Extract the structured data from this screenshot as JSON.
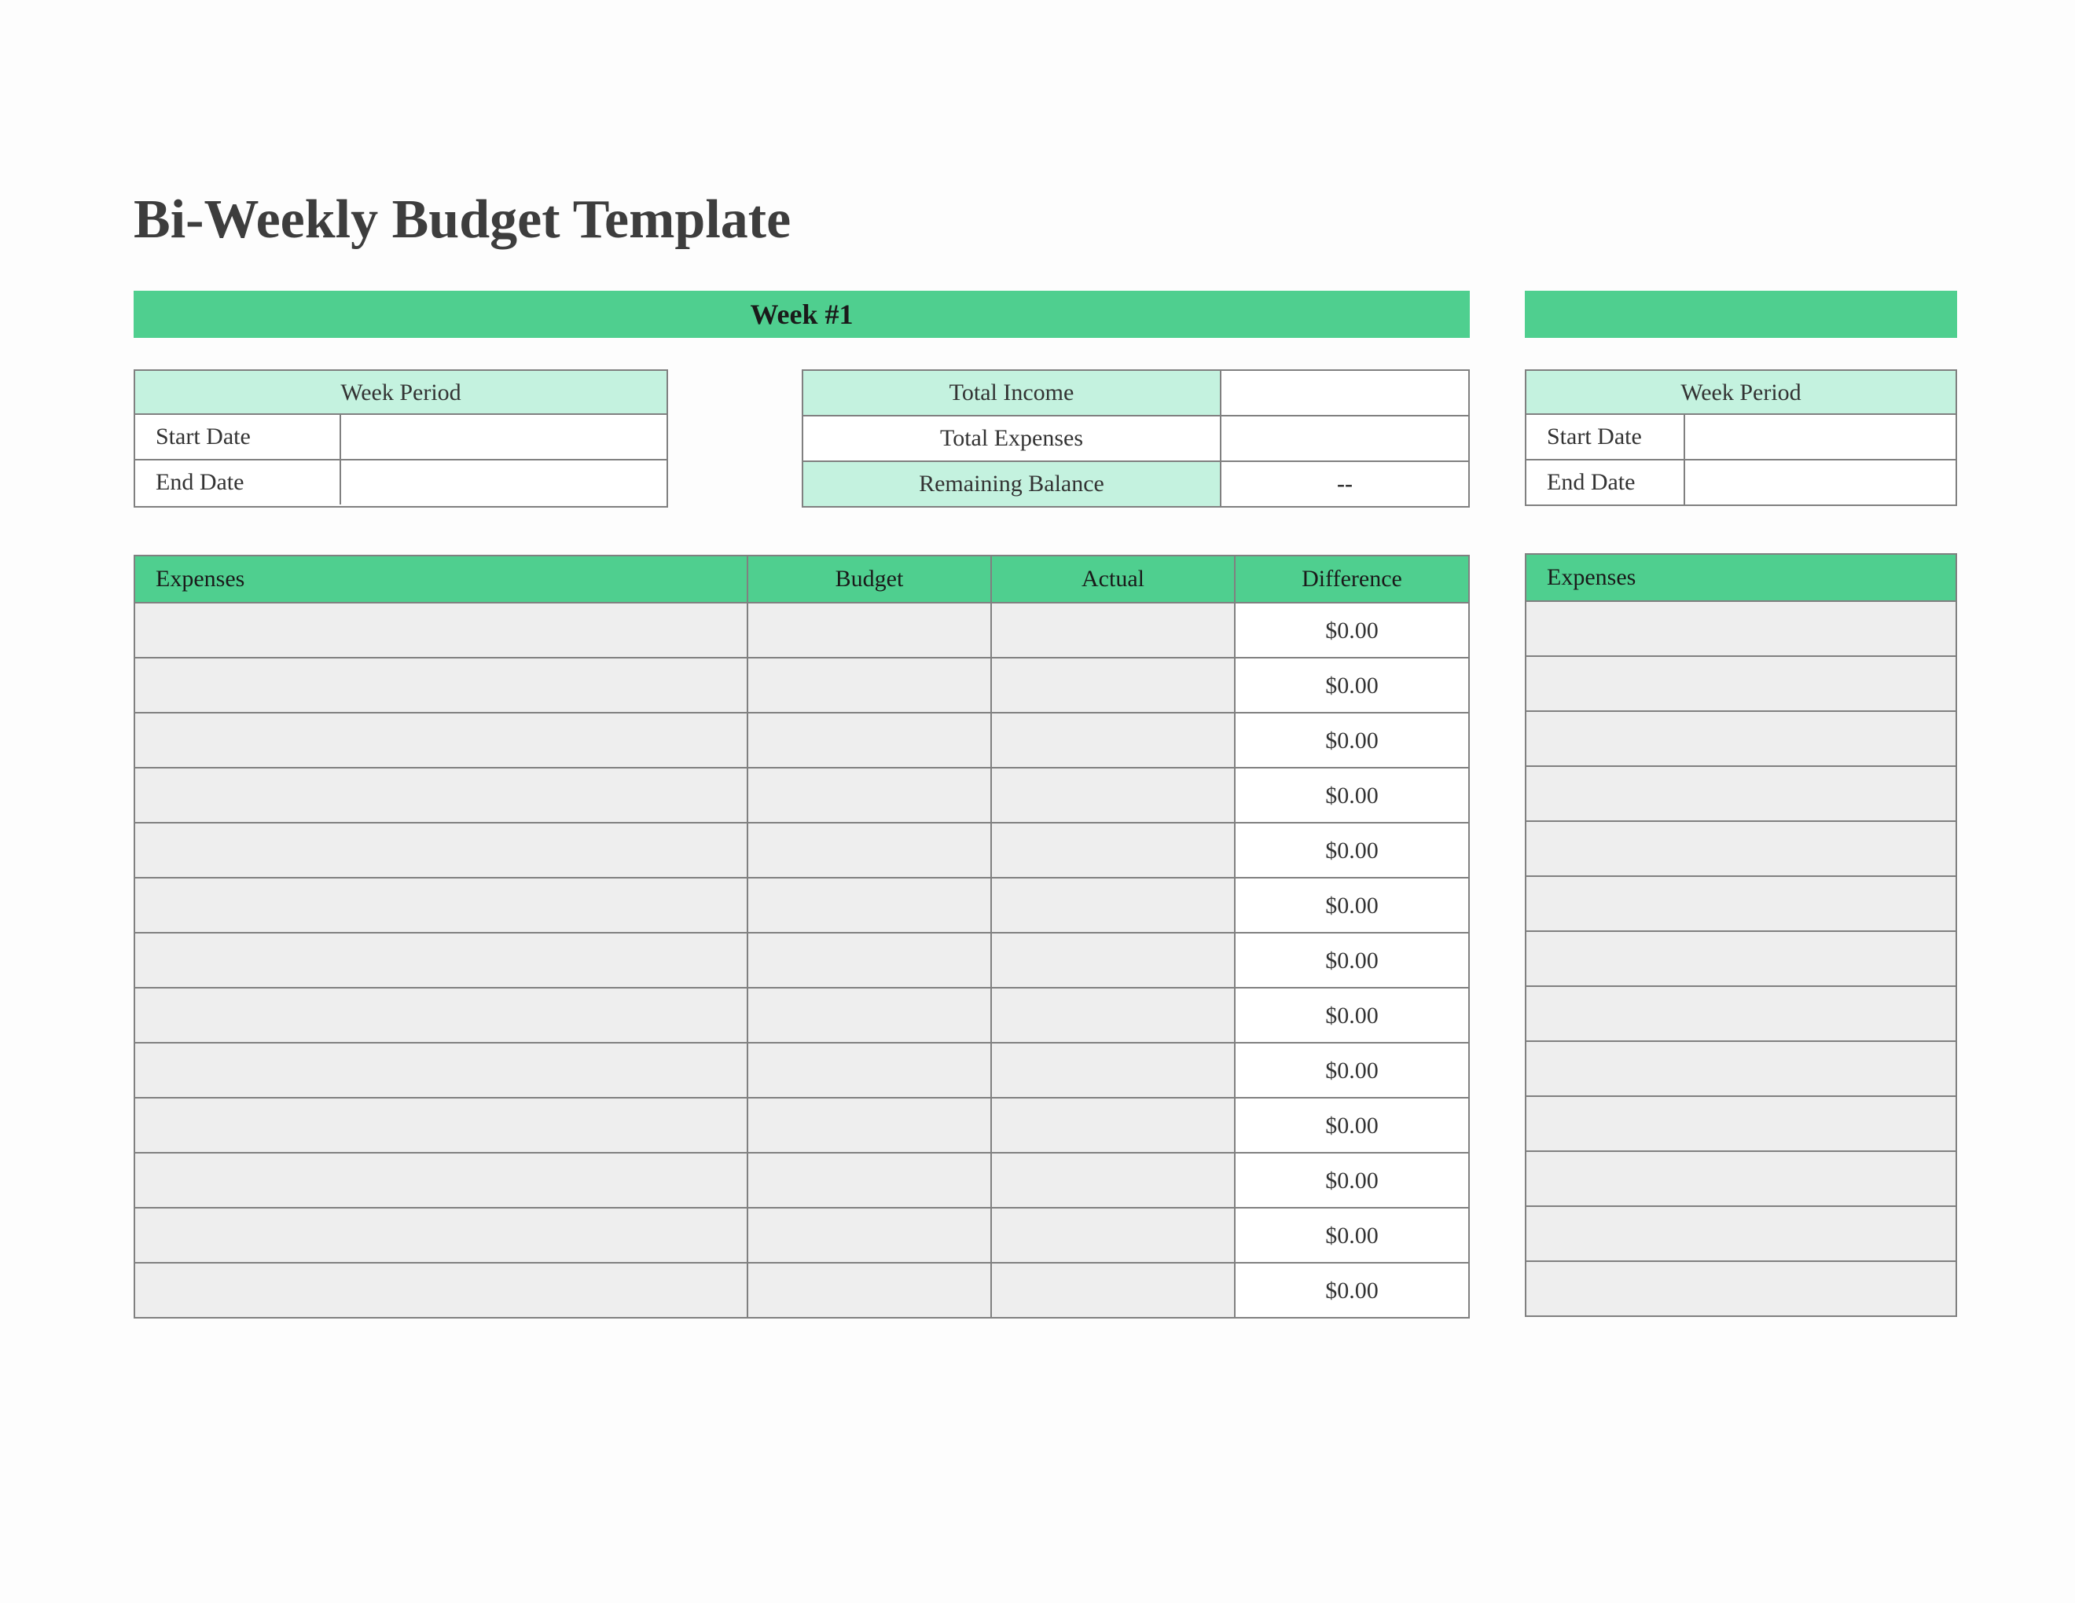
{
  "title": "Bi-Weekly Budget Template",
  "week1": {
    "banner": "Week #1",
    "period": {
      "header": "Week Period",
      "start_label": "Start Date",
      "start_value": "",
      "end_label": "End Date",
      "end_value": ""
    },
    "totals": {
      "income_label": "Total Income",
      "income_value": "",
      "expenses_label": "Total Expenses",
      "expenses_value": "",
      "balance_label": "Remaining Balance",
      "balance_value": "--"
    },
    "expenses": {
      "headers": {
        "expenses": "Expenses",
        "budget": "Budget",
        "actual": "Actual",
        "difference": "Difference"
      },
      "rows": [
        {
          "name": "",
          "budget": "",
          "actual": "",
          "difference": "$0.00"
        },
        {
          "name": "",
          "budget": "",
          "actual": "",
          "difference": "$0.00"
        },
        {
          "name": "",
          "budget": "",
          "actual": "",
          "difference": "$0.00"
        },
        {
          "name": "",
          "budget": "",
          "actual": "",
          "difference": "$0.00"
        },
        {
          "name": "",
          "budget": "",
          "actual": "",
          "difference": "$0.00"
        },
        {
          "name": "",
          "budget": "",
          "actual": "",
          "difference": "$0.00"
        },
        {
          "name": "",
          "budget": "",
          "actual": "",
          "difference": "$0.00"
        },
        {
          "name": "",
          "budget": "",
          "actual": "",
          "difference": "$0.00"
        },
        {
          "name": "",
          "budget": "",
          "actual": "",
          "difference": "$0.00"
        },
        {
          "name": "",
          "budget": "",
          "actual": "",
          "difference": "$0.00"
        },
        {
          "name": "",
          "budget": "",
          "actual": "",
          "difference": "$0.00"
        },
        {
          "name": "",
          "budget": "",
          "actual": "",
          "difference": "$0.00"
        },
        {
          "name": "",
          "budget": "",
          "actual": "",
          "difference": "$0.00"
        }
      ]
    }
  },
  "week2": {
    "banner": "",
    "period": {
      "header": "Week Period",
      "start_label": "Start Date",
      "start_value": "",
      "end_label": "End Date",
      "end_value": ""
    },
    "expenses": {
      "headers": {
        "expenses": "Expenses"
      },
      "rows": [
        {
          "name": ""
        },
        {
          "name": ""
        },
        {
          "name": ""
        },
        {
          "name": ""
        },
        {
          "name": ""
        },
        {
          "name": ""
        },
        {
          "name": ""
        },
        {
          "name": ""
        },
        {
          "name": ""
        },
        {
          "name": ""
        },
        {
          "name": ""
        },
        {
          "name": ""
        },
        {
          "name": ""
        }
      ]
    }
  }
}
